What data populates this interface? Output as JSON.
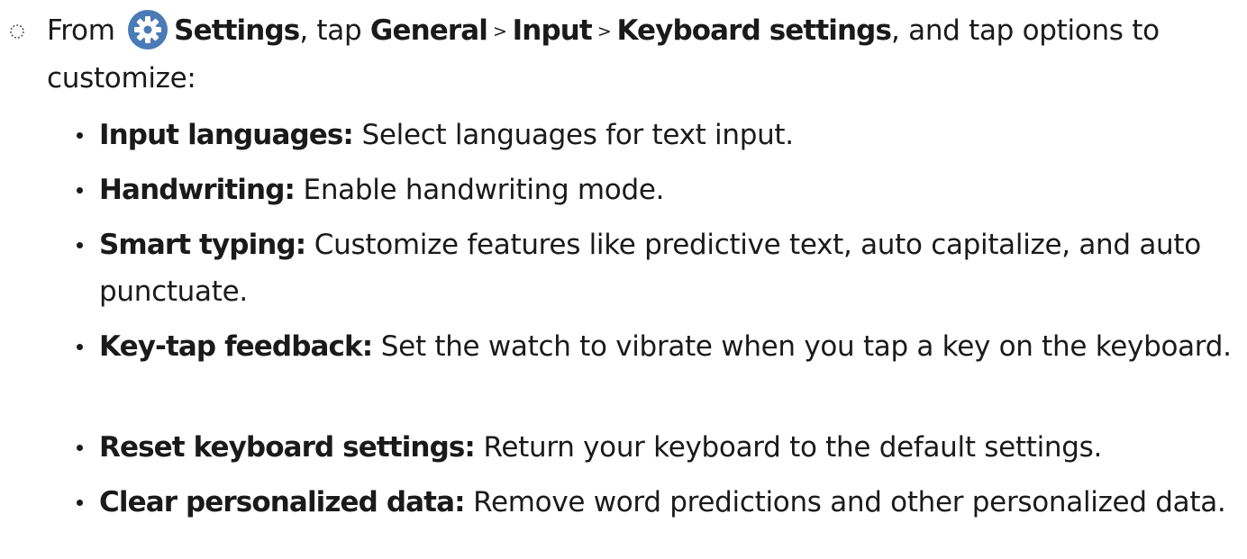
{
  "step": {
    "prefix": "From",
    "app_name": "Settings",
    "after_app": ", tap",
    "path": [
      "General",
      "Input",
      "Keyboard settings"
    ],
    "separator": ">",
    "suffix": ", and tap options to customize:",
    "icon": "gear-icon",
    "icon_color": "#4a7bb7"
  },
  "options": [
    {
      "term": "Input languages:",
      "desc": " Select languages for text input."
    },
    {
      "term": "Handwriting:",
      "desc": " Enable handwriting mode."
    },
    {
      "term": "Smart typing:",
      "desc": " Customize features like predictive text, auto capitalize, and auto punctuate."
    },
    {
      "term": "Key-tap feedback:",
      "desc": " Set the watch to vibrate when you tap a key on the keyboard."
    },
    {
      "term": "Reset keyboard settings:",
      "desc": " Return your keyboard to the default settings."
    },
    {
      "term": "Clear personalized data:",
      "desc": " Remove word predictions and other personalized data."
    }
  ]
}
